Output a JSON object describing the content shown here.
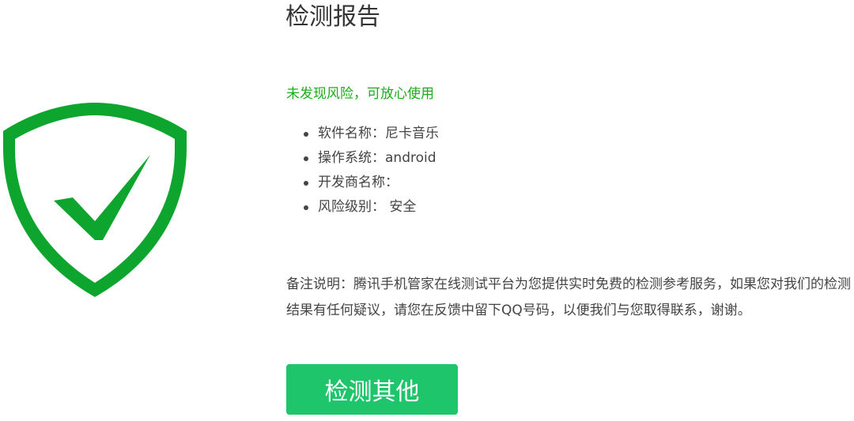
{
  "report": {
    "title": "检测报告",
    "status": "未发现风险，可放心使用",
    "details": [
      {
        "label": "软件名称：",
        "value": "尼卡音乐"
      },
      {
        "label": "操作系统：",
        "value": "android"
      },
      {
        "label": "开发商名称：",
        "value": ""
      },
      {
        "label": "风险级别：",
        "value": " 安全"
      }
    ],
    "note": "备注说明：腾讯手机管家在线测试平台为您提供实时免费的检测参考服务，如果您对我们的检测结果有任何疑议，请您在反馈中留下QQ号码，以便我们与您取得联系，谢谢。",
    "button_label": "检测其他"
  },
  "shield_icon": "shield-check-icon",
  "colors": {
    "shield_green": "#0ea52e",
    "status_green": "#1aad19",
    "button_green": "#1fc56b",
    "text": "#444444"
  }
}
